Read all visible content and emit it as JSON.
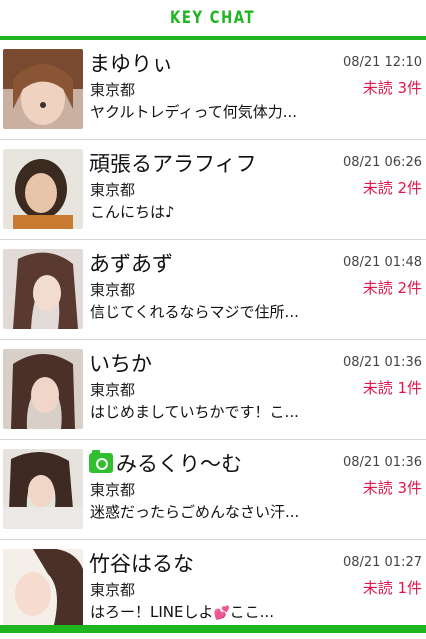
{
  "app": {
    "title": "KEY CHAT",
    "accent": "#1fb51f",
    "unread_color": "#e0174a"
  },
  "chats": [
    {
      "name": "まゆりぃ",
      "region": "東京都",
      "preview": "ヤクルトレディって何気体力...",
      "date": "08/21 12:10",
      "unread": "未読 3件",
      "has_camera": false
    },
    {
      "name": "頑張るアラフィフ",
      "region": "東京都",
      "preview": "こんにちは♪",
      "date": "08/21 06:26",
      "unread": "未読 2件",
      "has_camera": false
    },
    {
      "name": "あずあず",
      "region": "東京都",
      "preview": "信じてくれるならマジで住所...",
      "date": "08/21 01:48",
      "unread": "未読 2件",
      "has_camera": false
    },
    {
      "name": "いちか",
      "region": "東京都",
      "preview": "はじめましていちかです！こ...",
      "date": "08/21 01:36",
      "unread": "未読 1件",
      "has_camera": false
    },
    {
      "name": "みるくり〜む",
      "region": "東京都",
      "preview": "迷惑だったらごめんなさい汗...",
      "date": "08/21 01:36",
      "unread": "未読 3件",
      "has_camera": true
    },
    {
      "name": "竹谷はるな",
      "region": "東京都",
      "preview_before": "はろー！LINEしよ",
      "preview_heart": "💕",
      "preview_after": "ここ...",
      "date": "08/21 01:27",
      "unread": "未読 1件",
      "has_camera": false
    }
  ]
}
